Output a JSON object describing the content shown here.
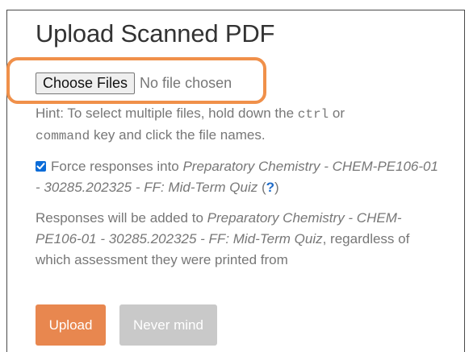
{
  "dialog": {
    "title": "Upload Scanned PDF"
  },
  "file_input": {
    "button_label": "Choose Files",
    "status": "No file chosen",
    "highlight_color": "#f0904a"
  },
  "hint": {
    "prefix": "Hint: To select multiple files, hold down the ",
    "key1": "ctrl",
    "mid": " or ",
    "key2": "command",
    "suffix": " key and click the file names."
  },
  "force": {
    "checked": true,
    "label_prefix": "Force responses into ",
    "assessment": "Preparatory Chemistry - CHEM-PE106-01 - 30285.202325 - FF: Mid-Term Quiz",
    "paren_open": " (",
    "help": "?",
    "paren_close": ")"
  },
  "note": {
    "prefix": "Responses will be added to ",
    "assessment": "Preparatory Chemistry - CHEM-PE106-01 - 30285.202325 - FF: Mid-Term Quiz",
    "suffix": ", regardless of which assessment they were printed from"
  },
  "buttons": {
    "upload": "Upload",
    "never_mind": "Never mind",
    "upload_color": "#e8874f",
    "never_mind_color": "#c9c9c9"
  }
}
